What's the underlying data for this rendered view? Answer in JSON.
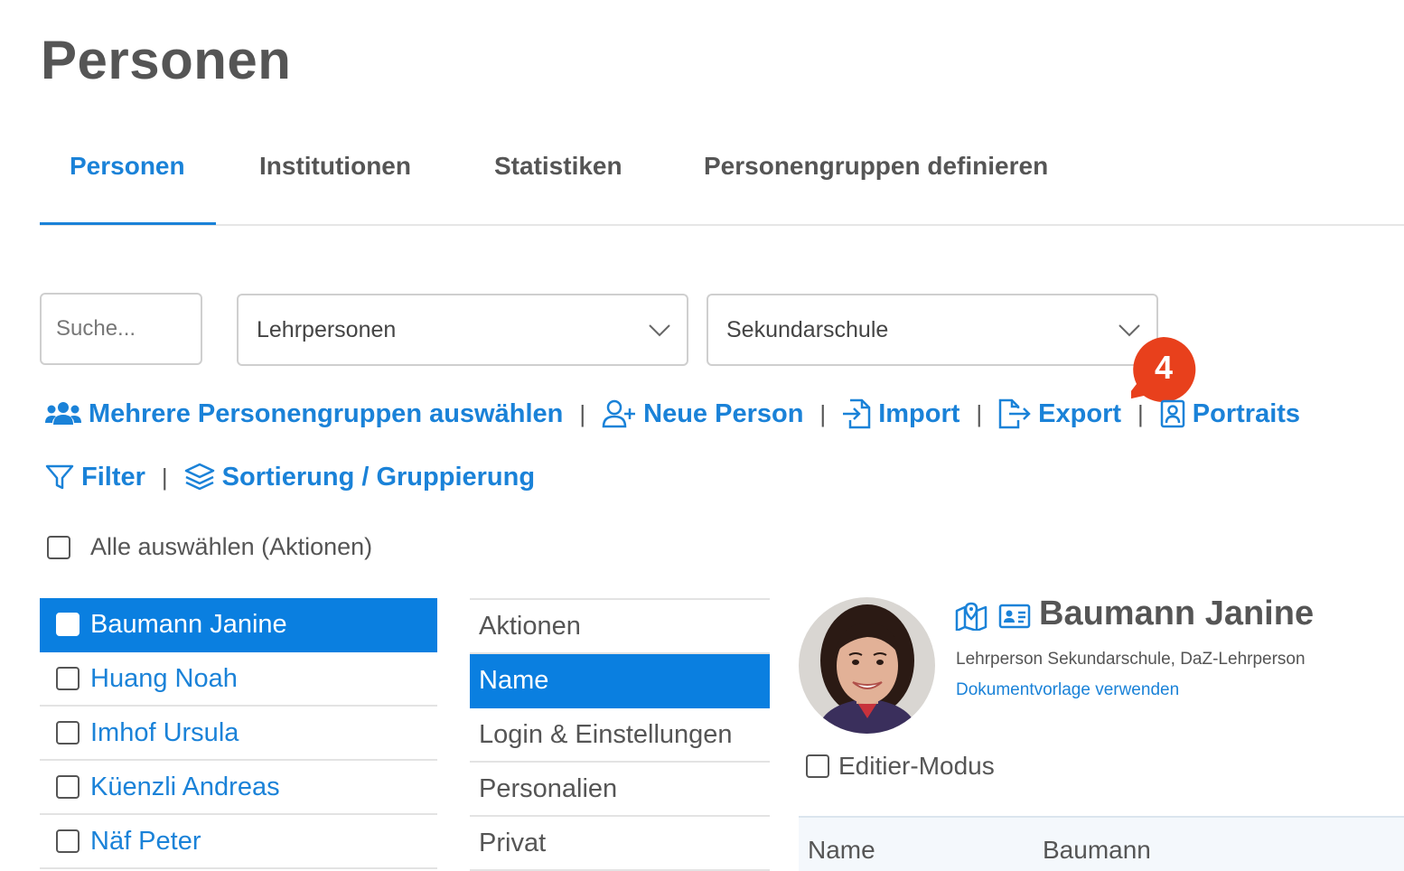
{
  "page": {
    "title": "Personen"
  },
  "tabs": [
    {
      "label": "Personen",
      "active": true
    },
    {
      "label": "Institutionen",
      "active": false
    },
    {
      "label": "Statistiken",
      "active": false
    },
    {
      "label": "Personengruppen definieren",
      "active": false
    }
  ],
  "filters": {
    "search_placeholder": "Suche...",
    "group_select": "Lehrpersonen",
    "school_select": "Sekundarschule"
  },
  "badge": {
    "number": "4",
    "color": "#e8401c"
  },
  "actions": {
    "multi_groups": "Mehrere Personengruppen auswählen",
    "new_person": "Neue Person",
    "import": "Import",
    "export": "Export",
    "portraits": "Portraits",
    "filter": "Filter",
    "sorting": "Sortierung / Gruppierung",
    "separator": "|"
  },
  "select_all": "Alle auswählen (Aktionen)",
  "people": [
    {
      "name": "Baumann Janine",
      "selected": true
    },
    {
      "name": "Huang Noah",
      "selected": false
    },
    {
      "name": "Imhof Ursula",
      "selected": false
    },
    {
      "name": "Küenzli Andreas",
      "selected": false
    },
    {
      "name": "Näf Peter",
      "selected": false
    }
  ],
  "sections": [
    {
      "label": "Aktionen",
      "selected": false
    },
    {
      "label": "Name",
      "selected": true
    },
    {
      "label": "Login & Einstellungen",
      "selected": false
    },
    {
      "label": "Personalien",
      "selected": false
    },
    {
      "label": "Privat",
      "selected": false
    }
  ],
  "detail": {
    "name": "Baumann Janine",
    "role": "Lehrperson Sekundarschule, DaZ-Lehrperson",
    "template_link": "Dokumentvorlage verwenden",
    "edit_mode": "Editier-Modus",
    "table": {
      "label": "Name",
      "value": "Baumann"
    }
  },
  "colors": {
    "accent": "#1a82d8",
    "selected_bg": "#0a7fe0",
    "text": "#555555"
  }
}
